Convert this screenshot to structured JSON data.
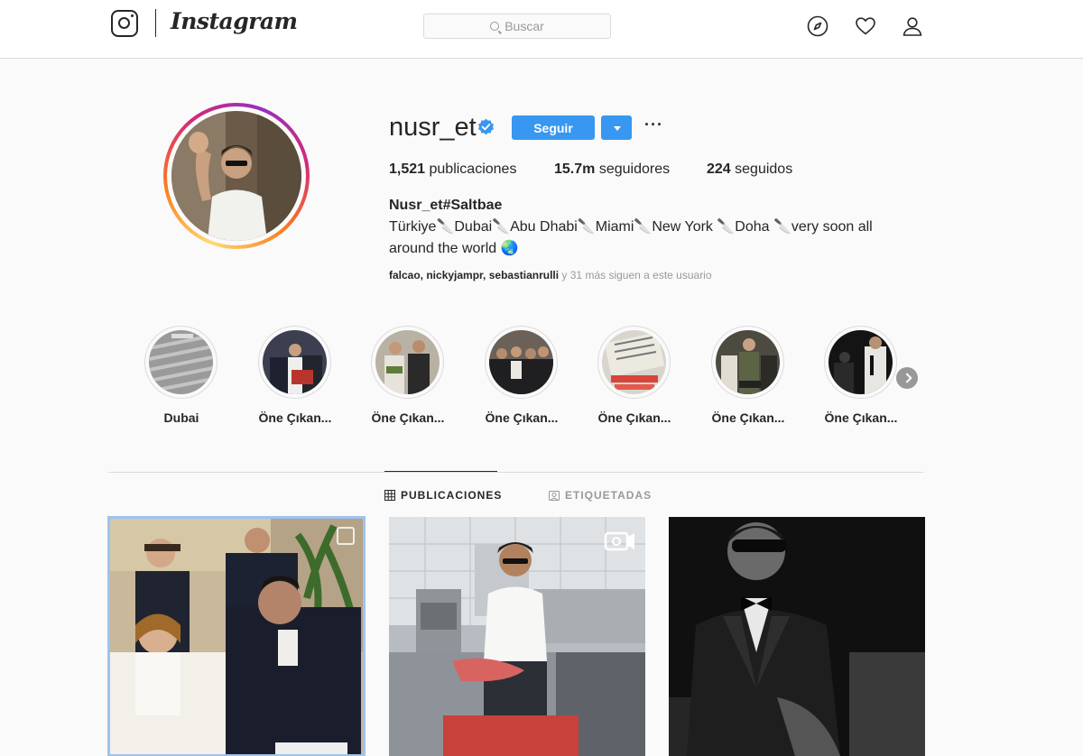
{
  "nav": {
    "wordmark": "Instagram",
    "search_placeholder": "Buscar",
    "icons": [
      "compass-icon",
      "heart-icon",
      "user-icon"
    ]
  },
  "profile": {
    "username": "nusr_et",
    "verified": true,
    "follow_label": "Seguir",
    "stats": {
      "posts_count": "1,521",
      "posts_label": " publicaciones",
      "followers_count": "15.7m",
      "followers_label": " seguidores",
      "following_count": "224",
      "following_label": " seguidos"
    },
    "full_name": "Nusr_et#Saltbae",
    "bio": "Türkiye🔪Dubai🔪Abu Dhabi🔪Miami🔪New York 🔪Doha 🔪very soon all around the world 🌏",
    "followed_by": {
      "names": "falcao, nickyjampr, sebastianrulli",
      "suffix": " y 31 más siguen a este usuario"
    }
  },
  "highlights": [
    {
      "label": "Dubai"
    },
    {
      "label": "Öne Çıkan..."
    },
    {
      "label": "Öne Çıkan..."
    },
    {
      "label": "Öne Çıkan..."
    },
    {
      "label": "Öne Çıkan..."
    },
    {
      "label": "Öne Çıkan..."
    },
    {
      "label": "Öne Çıkan..."
    }
  ],
  "tabs": {
    "posts": "PUBLICACIONES",
    "tagged": "ETIQUETADAS",
    "active": "posts"
  },
  "colors": {
    "accent": "#3897f0",
    "text": "#262626",
    "muted": "#999999",
    "border": "#dbdbdb"
  }
}
